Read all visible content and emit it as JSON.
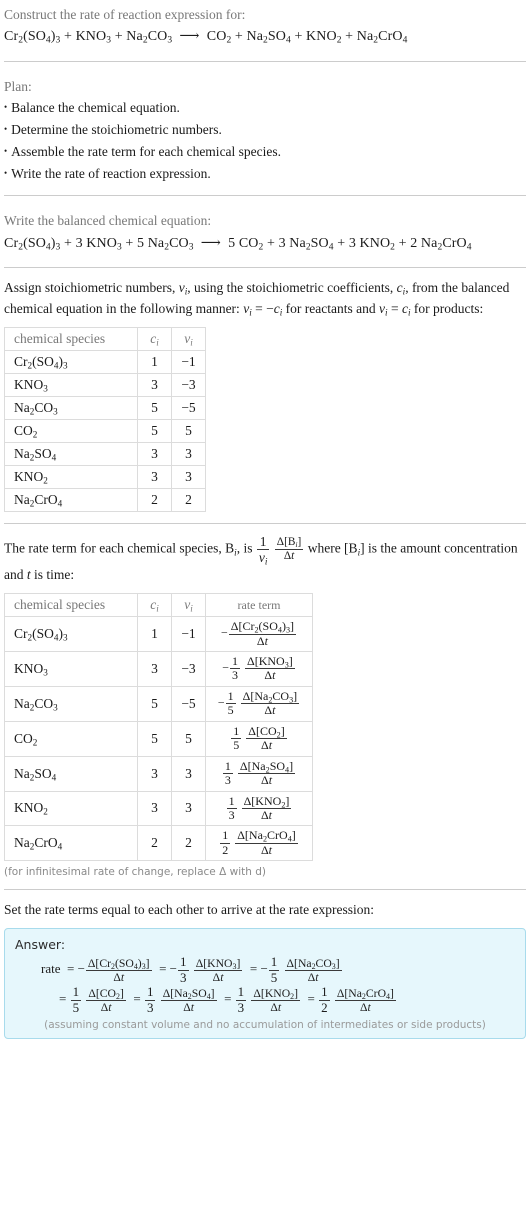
{
  "question": {
    "prompt": "Construct the rate of reaction expression for:",
    "equation_plain": "Cr2(SO4)3 + KNO3 + Na2CO3 ⟶ CO2 + Na2SO4 + KNO2 + Na2CrO4",
    "reactants": [
      "Cr2(SO4)3",
      "KNO3",
      "Na2CO3"
    ],
    "products": [
      "CO2",
      "Na2SO4",
      "KNO2",
      "Na2CrO4"
    ],
    "arrow": "⟶"
  },
  "plan": {
    "heading": "Plan:",
    "steps": [
      "Balance the chemical equation.",
      "Determine the stoichiometric numbers.",
      "Assemble the rate term for each chemical species.",
      "Write the rate of reaction expression."
    ]
  },
  "balanced": {
    "heading": "Write the balanced chemical equation:",
    "equation_plain": "Cr2(SO4)3 + 3 KNO3 + 5 Na2CO3 ⟶ 5 CO2 + 3 Na2SO4 + 3 KNO2 + 2 Na2CrO4",
    "reactant_coefficients": [
      "",
      "3",
      "5"
    ],
    "product_coefficients": [
      "5",
      "3",
      "3",
      "2"
    ],
    "arrow": "⟶"
  },
  "stoich_intro": {
    "line1_a": "Assign stoichiometric numbers, ",
    "line1_b": ", using the stoichiometric coefficients, ",
    "line1_c": ", from the balanced chemical equation in the following manner: ",
    "line1_d": " for reactants and ",
    "line1_e": " for products:",
    "nu_symbol": "ν",
    "c_symbol": "c",
    "i_symbol": "i",
    "relation_reactants": "νi = −ci",
    "relation_products": "νi = ci"
  },
  "table1": {
    "headers": [
      "chemical species",
      "ci",
      "νi"
    ],
    "rows": [
      {
        "species": "Cr2(SO4)3",
        "c": "1",
        "v": "−1"
      },
      {
        "species": "KNO3",
        "c": "3",
        "v": "−3"
      },
      {
        "species": "Na2CO3",
        "c": "5",
        "v": "−5"
      },
      {
        "species": "CO2",
        "c": "5",
        "v": "5"
      },
      {
        "species": "Na2SO4",
        "c": "3",
        "v": "3"
      },
      {
        "species": "KNO2",
        "c": "3",
        "v": "3"
      },
      {
        "species": "Na2CrO4",
        "c": "2",
        "v": "2"
      }
    ]
  },
  "rate_intro": {
    "text_a": "The rate term for each chemical species, ",
    "species_symbol": "Bi",
    "text_b": ", is ",
    "formula": "1/νi · Δ[Bi]/Δt",
    "text_c": " where ",
    "text_d": " is the amount concentration and t is time:"
  },
  "table2": {
    "headers": [
      "chemical species",
      "ci",
      "νi",
      "rate term"
    ],
    "rows": [
      {
        "species": "Cr2(SO4)3",
        "c": "1",
        "v": "−1",
        "sign": "−",
        "coef_num": "",
        "coef_den": "",
        "delta": "Δ[Cr2(SO4)3]",
        "dt": "Δt"
      },
      {
        "species": "KNO3",
        "c": "3",
        "v": "−3",
        "sign": "−",
        "coef_num": "1",
        "coef_den": "3",
        "delta": "Δ[KNO3]",
        "dt": "Δt"
      },
      {
        "species": "Na2CO3",
        "c": "5",
        "v": "−5",
        "sign": "−",
        "coef_num": "1",
        "coef_den": "5",
        "delta": "Δ[Na2CO3]",
        "dt": "Δt"
      },
      {
        "species": "CO2",
        "c": "5",
        "v": "5",
        "sign": "",
        "coef_num": "1",
        "coef_den": "5",
        "delta": "Δ[CO2]",
        "dt": "Δt"
      },
      {
        "species": "Na2SO4",
        "c": "3",
        "v": "3",
        "sign": "",
        "coef_num": "1",
        "coef_den": "3",
        "delta": "Δ[Na2SO4]",
        "dt": "Δt"
      },
      {
        "species": "KNO2",
        "c": "3",
        "v": "3",
        "sign": "",
        "coef_num": "1",
        "coef_den": "3",
        "delta": "Δ[KNO2]",
        "dt": "Δt"
      },
      {
        "species": "Na2CrO4",
        "c": "2",
        "v": "2",
        "sign": "",
        "coef_num": "1",
        "coef_den": "2",
        "delta": "Δ[Na2CrO4]",
        "dt": "Δt"
      }
    ]
  },
  "footnote": "(for infinitesimal rate of change, replace Δ with d)",
  "final": {
    "heading": "Set the rate terms equal to each other to arrive at the rate expression:",
    "answer_label": "Answer:",
    "rate_word": "rate",
    "expression_plain": "rate = −Δ[Cr2(SO4)3]/Δt = −1/3 Δ[KNO3]/Δt = −1/5 Δ[Na2CO3]/Δt = 1/5 Δ[CO2]/Δt = 1/3 Δ[Na2SO4]/Δt = 1/3 Δ[KNO2]/Δt = 1/2 Δ[Na2CrO4]/Δt",
    "assumption": "(assuming constant volume and no accumulation of intermediates or side products)"
  },
  "colors": {
    "prompt_text": "#787878",
    "body_text": "#1a1a1a",
    "divider": "#cccccc",
    "answer_border": "#a8dbec",
    "answer_bg": "#e6f7fc",
    "note_text": "#8a8a8a"
  }
}
